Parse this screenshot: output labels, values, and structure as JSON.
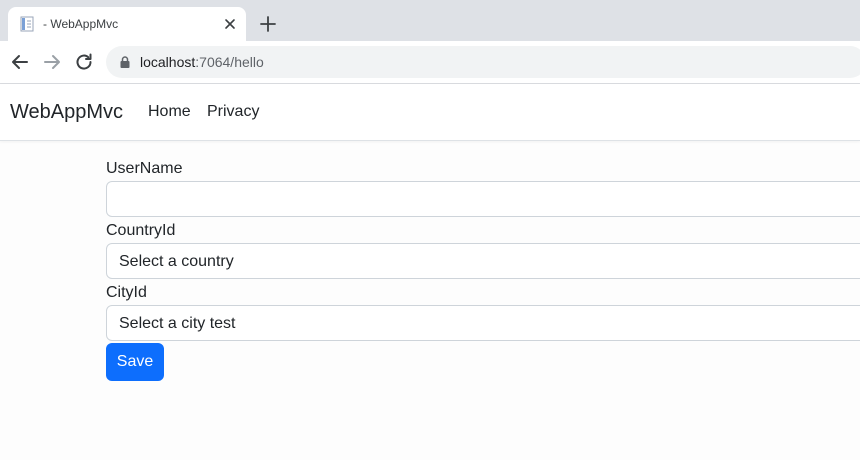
{
  "browser": {
    "tab": {
      "title": "- WebAppMvc",
      "favicon": "page-icon",
      "close_icon": "close-icon"
    },
    "new_tab_icon": "plus-icon",
    "toolbar": {
      "back_icon": "arrow-left-icon",
      "forward_icon": "arrow-right-icon",
      "reload_icon": "reload-icon",
      "lock_icon": "lock-icon",
      "url_host": "localhost",
      "url_path": ":7064/hello"
    }
  },
  "navbar": {
    "brand": "WebAppMvc",
    "links": [
      "Home",
      "Privacy"
    ]
  },
  "form": {
    "username": {
      "label": "UserName",
      "value": ""
    },
    "country": {
      "label": "CountryId",
      "selected": "Select a country"
    },
    "city": {
      "label": "CityId",
      "selected": "Select a city test"
    },
    "submit_label": "Save"
  },
  "colors": {
    "primary": "#0d6efd",
    "tabstrip": "#dee1e6",
    "omnibox": "#f1f3f4"
  }
}
